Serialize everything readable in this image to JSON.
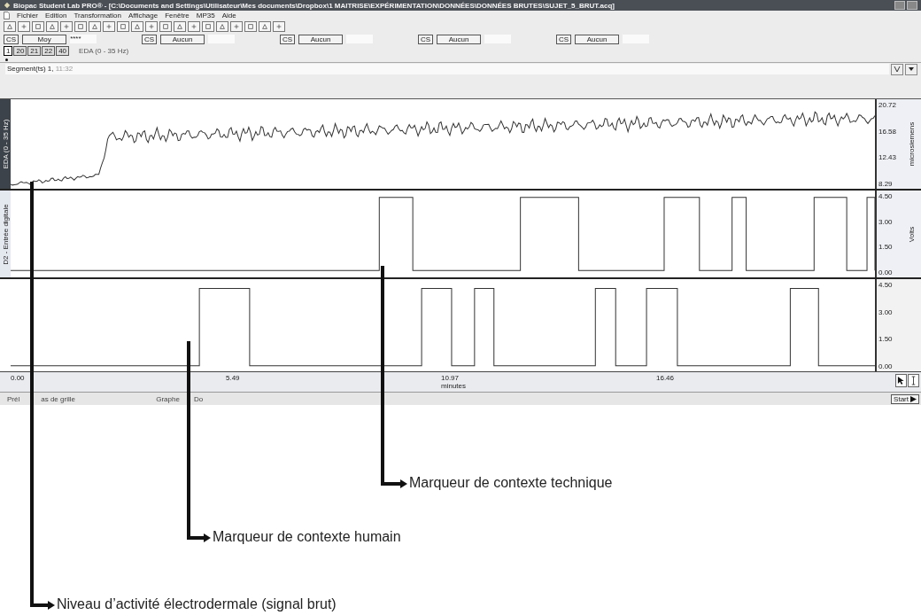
{
  "window": {
    "title": "Biopac Student Lab PRO® - [C:\\Documents and Settings\\Utilisateur\\Mes documents\\Dropbox\\1 MAITRISE\\EXPÉRIMENTATION\\DONNÉES\\DONNÉES BRUTES\\SUJET_5_BRUT.acq]"
  },
  "menu": [
    "Fichier",
    "Edition",
    "Transformation",
    "Affichage",
    "Fenêtre",
    "MP35",
    "Aide"
  ],
  "measurements": [
    {
      "cs": "CS",
      "value": "Moy",
      "reading": "****"
    },
    {
      "cs": "CS",
      "value": "Aucun"
    },
    {
      "cs": "CS",
      "value": "Aucun"
    },
    {
      "cs": "CS",
      "value": "Aucun"
    },
    {
      "cs": "CS",
      "value": "Aucun"
    }
  ],
  "channel_tabs": [
    {
      "label": "1",
      "selected": true
    },
    {
      "label": "20",
      "selected": false
    },
    {
      "label": "21",
      "selected": false
    },
    {
      "label": "22",
      "selected": false
    },
    {
      "label": "40",
      "selected": false
    }
  ],
  "channel_name": "EDA (0 - 35 Hz)",
  "journal": {
    "segment": "Segment(ts) 1,",
    "time": "11:32"
  },
  "panels": [
    {
      "kind": "analog",
      "label": "EDA (0 - 35 Hz)",
      "unit": "microsiemens",
      "scale": [
        "20.72",
        "16.58",
        "12.43",
        "8.29"
      ]
    },
    {
      "kind": "digital",
      "label": "D2 - Entrée digitale",
      "unit": "Volts",
      "scale": [
        "4.50",
        "3.00",
        "1.50",
        "0.00"
      ]
    },
    {
      "kind": "digital2",
      "scale": [
        "4.50",
        "3.00",
        "1.50",
        "0.00"
      ]
    }
  ],
  "time_axis": {
    "ticks": [
      "0.00",
      "5.49",
      "10.97",
      "16.46"
    ],
    "unit": "minutes"
  },
  "status_bar": [
    "Prél",
    "as de grille",
    "Graphe",
    "Do"
  ],
  "start_button": "Start",
  "annotations": [
    {
      "text": "Marqueur de contexte technique"
    },
    {
      "text": "Marqueur de contexte humain"
    },
    {
      "text": "Niveau d’activité électrodermale (signal brut)"
    }
  ]
}
